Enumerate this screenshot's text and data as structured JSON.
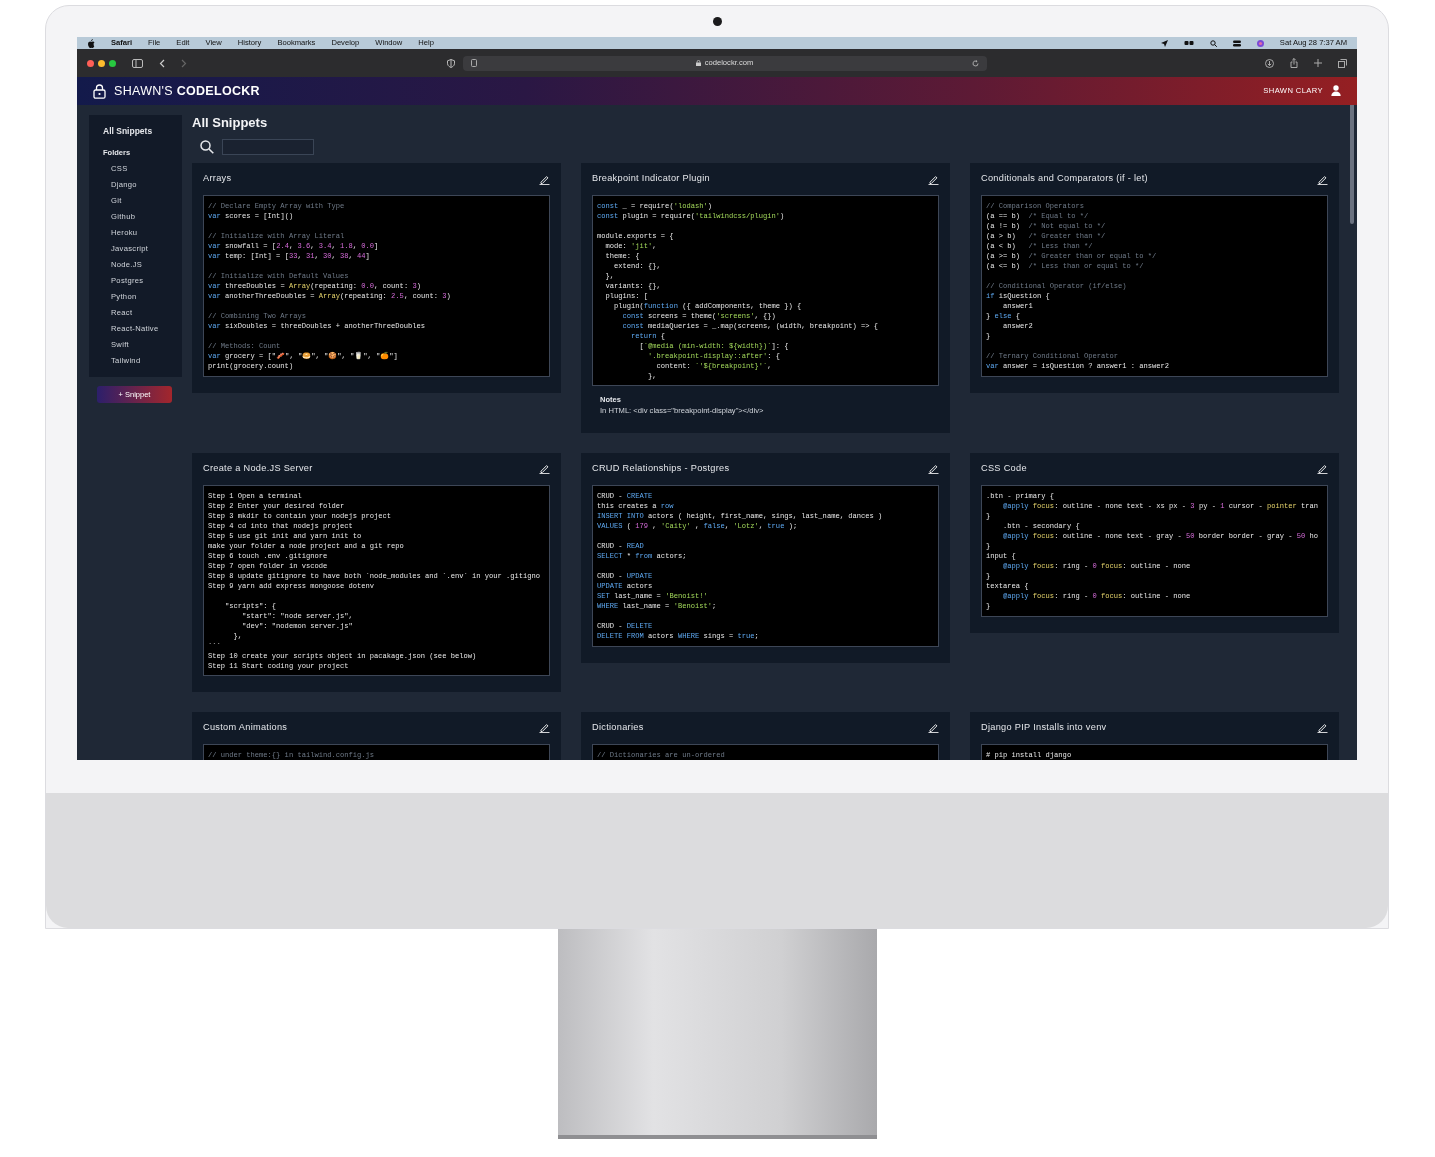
{
  "menu_bar": {
    "app": "Safari",
    "items": [
      "File",
      "Edit",
      "View",
      "History",
      "Bookmarks",
      "Develop",
      "Window",
      "Help"
    ],
    "clock": "Sat Aug 28  7:37 AM"
  },
  "browser": {
    "url": "codelockr.com"
  },
  "app_header": {
    "title": "SHAWN'S **CODELOCKR**",
    "user": "SHAWN CLARY"
  },
  "sidebar": {
    "all_label": "All Snippets",
    "folders_label": "Folders",
    "folders": [
      "CSS",
      "Django",
      "Git",
      "Github",
      "Heroku",
      "Javascript",
      "Node.JS",
      "Postgres",
      "Python",
      "React",
      "React-Native",
      "Swift",
      "Tailwind"
    ],
    "new_button": "+ Snippet"
  },
  "main": {
    "title": "All Snippets"
  },
  "snippets": [
    {
      "title": "Arrays",
      "code": [
        [
          [
            {
              "text": "// Declare Empty Array with Type",
              "kind": "comment"
            }
          ],
          [
            {
              "text": "var",
              "kind": "keyword"
            },
            " scores = [Int]()"
          ]
        ],
        [
          [
            {
              "text": "// Initialize with Array Literal",
              "kind": "comment"
            }
          ],
          [
            {
              "text": "var",
              "kind": "keyword"
            },
            " snowfall = [",
            {
              "text": "2.4",
              "kind": "number"
            },
            ", ",
            {
              "text": "3.6",
              "kind": "number"
            },
            ", ",
            {
              "text": "3.4",
              "kind": "number"
            },
            ", ",
            {
              "text": "1.8",
              "kind": "number"
            },
            ", ",
            {
              "text": "0.0",
              "kind": "number"
            },
            "]"
          ],
          [
            {
              "text": "var",
              "kind": "keyword"
            },
            " temp: [Int] = [",
            {
              "text": "33",
              "kind": "number"
            },
            ", ",
            {
              "text": "31",
              "kind": "number"
            },
            ", ",
            {
              "text": "30",
              "kind": "number"
            },
            ", ",
            {
              "text": "38",
              "kind": "number"
            },
            ", ",
            {
              "text": "44",
              "kind": "number"
            },
            "]"
          ]
        ],
        [
          [
            {
              "text": "// Initialize with Default Values",
              "kind": "comment"
            }
          ],
          [
            {
              "text": "var",
              "kind": "keyword"
            },
            " threeDoubles = ",
            {
              "text": "Array",
              "kind": "function"
            },
            "(repeating: ",
            {
              "text": "0.0",
              "kind": "number"
            },
            ", count: ",
            {
              "text": "3",
              "kind": "number"
            },
            ")"
          ],
          [
            {
              "text": "var",
              "kind": "keyword"
            },
            " anotherThreeDoubles = ",
            {
              "text": "Array",
              "kind": "function"
            },
            "(repeating: ",
            {
              "text": "2.5",
              "kind": "number"
            },
            ", count: ",
            {
              "text": "3",
              "kind": "number"
            },
            ")"
          ]
        ],
        [
          [
            {
              "text": "// Combining Two Arrays",
              "kind": "comment"
            }
          ],
          [
            {
              "text": "var",
              "kind": "keyword"
            },
            " sixDoubles = threeDoubles + anotherThreeDoubles"
          ]
        ],
        [
          [
            {
              "text": "// Methods: Count",
              "kind": "comment"
            }
          ],
          [
            {
              "text": "var",
              "kind": "keyword"
            },
            " grocery = [\"🥓\", \"🥯\", \"🍪\", \"🥛\", \"🍊\"]"
          ],
          "print(grocery.count)"
        ]
      ]
    },
    {
      "title": "Breakpoint Indicator Plugin",
      "code": [
        [
          [
            {
              "text": "const",
              "kind": "keyword"
            },
            " _ = require(",
            {
              "text": "'lodash'",
              "kind": "string"
            },
            ")"
          ],
          [
            {
              "text": "const",
              "kind": "keyword"
            },
            " plugin = require(",
            {
              "text": "'tailwindcss/plugin'",
              "kind": "string"
            },
            ")"
          ]
        ],
        [
          "module.exports = {",
          [
            "  mode: ",
            {
              "text": "'jit'",
              "kind": "string"
            },
            ","
          ],
          "  theme: {",
          "    extend: {},",
          "  },",
          "  variants: {},",
          "  plugins: [",
          [
            "    plugin(",
            {
              "text": "function",
              "kind": "keyword"
            },
            " ({ addComponents, theme }) {"
          ],
          [
            {
              "text": "      const",
              "kind": "keyword"
            },
            " screens = theme(",
            {
              "text": "'screens'",
              "kind": "string"
            },
            ", {})"
          ],
          [
            {
              "text": "      const",
              "kind": "keyword"
            },
            " mediaQueries = _.map(screens, (width, breakpoint) => {"
          ],
          [
            {
              "text": "        return",
              "kind": "keyword"
            },
            " {"
          ],
          [
            "          [",
            {
              "text": "`@media (min-width: ${width})`",
              "kind": "string"
            },
            "]: {"
          ],
          [
            {
              "text": "            '.breakpoint-display::after'",
              "kind": "string"
            },
            ": {"
          ],
          [
            "              content: ",
            {
              "text": "`'${breakpoint}'`",
              "kind": "string"
            },
            ","
          ],
          "            },"
        ]
      ],
      "notes_label": "Notes",
      "notes": "In HTML: <div class=\"breakpoint-display\"></div>"
    },
    {
      "title": "Conditionals and Comparators (if - let)",
      "code": [
        [
          [
            {
              "text": "// Comparison Operators",
              "kind": "comment"
            }
          ],
          [
            "(a == b)  ",
            {
              "text": "/* Equal to */",
              "kind": "comment"
            }
          ],
          [
            "(a != b)  ",
            {
              "text": "/* Not equal to */",
              "kind": "comment"
            }
          ],
          [
            "(a > b)   ",
            {
              "text": "/* Greater than */",
              "kind": "comment"
            }
          ],
          [
            "(a < b)   ",
            {
              "text": "/* Less than */",
              "kind": "comment"
            }
          ],
          [
            "(a >= b)  ",
            {
              "text": "/* Greater than or equal to */",
              "kind": "comment"
            }
          ],
          [
            "(a <= b)  ",
            {
              "text": "/* Less than or equal to */",
              "kind": "comment"
            }
          ]
        ],
        [
          [
            {
              "text": "// Conditional Operator (if/else)",
              "kind": "comment"
            }
          ],
          [
            {
              "text": "if",
              "kind": "keyword"
            },
            " isQuestion {"
          ],
          "    answer1",
          [
            "} ",
            {
              "text": "else",
              "kind": "keyword"
            },
            " {"
          ],
          "    answer2",
          "}"
        ],
        [
          [
            {
              "text": "// Ternary Conditional Operator",
              "kind": "comment"
            }
          ],
          [
            {
              "text": "var",
              "kind": "keyword"
            },
            " answer = isQuestion ? answer1 : answer2"
          ]
        ]
      ]
    },
    {
      "title": "Create a Node.JS Server",
      "code": [
        [
          "Step 1 Open a terminal",
          "Step 2 Enter your desired folder",
          "Step 3 mkdir to contain your nodejs project",
          "Step 4 cd into that nodejs project",
          "Step 5 use git init and yarn init to",
          "make your folder a node project and a git repo",
          "Step 6 touch .env .gitignore",
          "Step 7 open folder in vscode",
          "Step 8 update gitignore to have both `node_modules and `.env` in your .gitigno",
          "Step 9 yarn add express mongoose dotenv"
        ],
        [
          "    \"scripts\": {",
          "        \"start\": \"node server.js\",",
          "        \"dev\": \"nodemon server.js\"",
          "      },",
          "```",
          "Step 10 create your scripts object in pacakage.json (see below)",
          "Step 11 Start coding your project"
        ]
      ]
    },
    {
      "title": "CRUD Relationships - Postgres",
      "code": [
        [
          [
            "CRUD - ",
            {
              "text": "CREATE",
              "kind": "keyword"
            }
          ],
          [
            "this creates a ",
            {
              "text": "row",
              "kind": "keyword"
            }
          ],
          [
            {
              "text": "INSERT INTO",
              "kind": "keyword"
            },
            " actors ( height, first_name, sings, last_name, dances )"
          ],
          [
            {
              "text": "VALUES",
              "kind": "keyword"
            },
            " ( ",
            {
              "text": "179",
              "kind": "number"
            },
            " , ",
            {
              "text": "'Caity'",
              "kind": "string"
            },
            " , ",
            {
              "text": "false",
              "kind": "keyword"
            },
            ", ",
            {
              "text": "'Lotz'",
              "kind": "string"
            },
            ", ",
            {
              "text": "true",
              "kind": "keyword"
            },
            " );"
          ]
        ],
        [
          [
            "CRUD - ",
            {
              "text": "READ",
              "kind": "keyword"
            }
          ],
          [
            {
              "text": "SELECT",
              "kind": "keyword"
            },
            " * ",
            {
              "text": "from",
              "kind": "keyword"
            },
            " actors;"
          ]
        ],
        [
          [
            "CRUD - ",
            {
              "text": "UPDATE",
              "kind": "keyword"
            }
          ],
          [
            {
              "text": "UPDATE",
              "kind": "keyword"
            },
            " actors"
          ],
          [
            {
              "text": "SET",
              "kind": "keyword"
            },
            " last_name = ",
            {
              "text": "'Benoist!'",
              "kind": "string"
            }
          ],
          [
            {
              "text": "WHERE",
              "kind": "keyword"
            },
            " last_name = ",
            {
              "text": "'Benoist'",
              "kind": "string"
            },
            ";"
          ]
        ],
        [
          [
            "CRUD - ",
            {
              "text": "DELETE",
              "kind": "keyword"
            }
          ],
          [
            {
              "text": "DELETE FROM",
              "kind": "keyword"
            },
            " actors ",
            {
              "text": "WHERE",
              "kind": "keyword"
            },
            " sings = ",
            {
              "text": "true",
              "kind": "keyword"
            },
            ";"
          ]
        ]
      ]
    },
    {
      "title": "CSS Code",
      "code": [
        [
          ".btn - primary {",
          [
            {
              "text": "    @apply ",
              "kind": "keyword"
            },
            {
              "text": "focus",
              "kind": "function"
            },
            ": outline - none text - xs px - ",
            {
              "text": "3",
              "kind": "number"
            },
            " py - ",
            {
              "text": "1",
              "kind": "number"
            },
            " cursor - ",
            {
              "text": "pointer",
              "kind": "function"
            },
            " tran"
          ],
          "}",
          "    .btn - secondary {",
          [
            {
              "text": "    @apply ",
              "kind": "keyword"
            },
            {
              "text": "focus",
              "kind": "function"
            },
            ": outline - none text - gray - ",
            {
              "text": "50",
              "kind": "number"
            },
            " border border - gray - ",
            {
              "text": "50",
              "kind": "number"
            },
            " ho"
          ],
          "}",
          "input {",
          [
            {
              "text": "    @apply ",
              "kind": "keyword"
            },
            {
              "text": "focus",
              "kind": "function"
            },
            ": ring - ",
            {
              "text": "0 ",
              "kind": "number"
            },
            {
              "text": "focus",
              "kind": "function"
            },
            ": outline - none"
          ],
          "}",
          "textarea {",
          [
            {
              "text": "    @apply ",
              "kind": "keyword"
            },
            {
              "text": "focus",
              "kind": "function"
            },
            ": ring - ",
            {
              "text": "0 ",
              "kind": "number"
            },
            {
              "text": "focus",
              "kind": "function"
            },
            ": outline - none"
          ],
          "}"
        ]
      ]
    },
    {
      "title": "Custom Animations",
      "code": [
        [
          [
            {
              "text": "// under theme:{} in tailwind.config.js",
              "kind": "comment"
            }
          ]
        ]
      ]
    },
    {
      "title": "Dictionaries",
      "code": [
        [
          [
            {
              "text": "// Dictionaries are un-ordered",
              "kind": "comment"
            }
          ]
        ]
      ]
    },
    {
      "title": "Django PIP Installs into venv",
      "code": [
        [
          "# pip install django"
        ]
      ]
    }
  ]
}
